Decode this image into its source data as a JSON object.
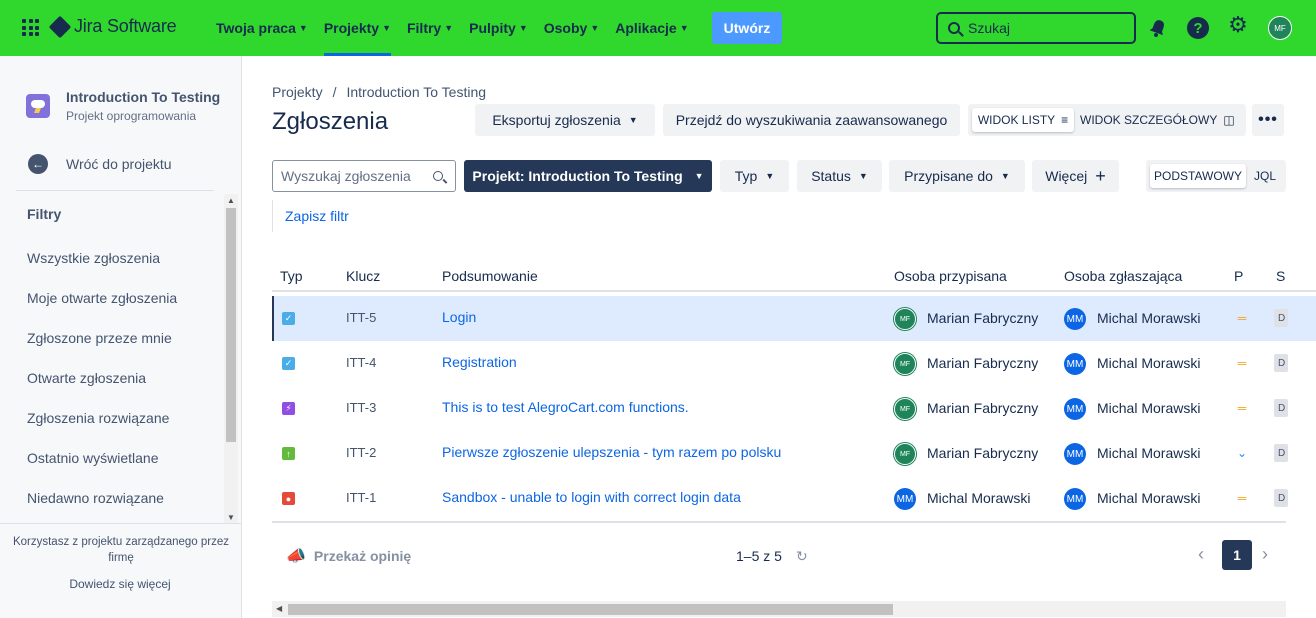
{
  "topbar": {
    "product": "Jira Software",
    "nav": [
      {
        "label": "Twoja praca",
        "active": false
      },
      {
        "label": "Projekty",
        "active": true
      },
      {
        "label": "Filtry",
        "active": false
      },
      {
        "label": "Pulpity",
        "active": false
      },
      {
        "label": "Osoby",
        "active": false
      },
      {
        "label": "Aplikacje",
        "active": false
      }
    ],
    "create_label": "Utwórz",
    "search_placeholder": "Szukaj",
    "user_initials": "MF",
    "bg_color": "#30d82e"
  },
  "sidebar": {
    "project_name": "Introduction To Testing",
    "project_type": "Projekt oprogramowania",
    "back_label": "Wróć do projektu",
    "filters_heading": "Filtry",
    "items": [
      {
        "label": "Wszystkie zgłoszenia"
      },
      {
        "label": "Moje otwarte zgłoszenia"
      },
      {
        "label": "Zgłoszone przeze mnie"
      },
      {
        "label": "Otwarte zgłoszenia"
      },
      {
        "label": "Zgłoszenia rozwiązane"
      },
      {
        "label": "Ostatnio wyświetlane"
      },
      {
        "label": "Niedawno rozwiązane"
      }
    ],
    "note": "Korzystasz z projektu zarządzanego przez firmę",
    "learn_more": "Dowiedz się więcej"
  },
  "main": {
    "breadcrumb": [
      "Projekty",
      "/",
      "Introduction To Testing"
    ],
    "title": "Zgłoszenia",
    "export_label": "Eksportuj zgłoszenia",
    "advanced_label": "Przejdź do wyszukiwania zaawansowanego",
    "view_list": "WIDOK LISTY",
    "view_detail": "WIDOK SZCZEGÓŁOWY",
    "more_label": "•••",
    "search_placeholder": "Wyszukaj zgłoszenia",
    "project_filter": "Projekt: Introduction To Testing",
    "type_filter": "Typ",
    "status_filter": "Status",
    "assignee_filter": "Przypisane do",
    "more_filter": "Więcej",
    "basic_label": "PODSTAWOWY",
    "jql_label": "JQL",
    "save_filter": "Zapisz filtr"
  },
  "table": {
    "headers": [
      "Typ",
      "Klucz",
      "Podsumowanie",
      "Osoba przypisana",
      "Osoba zgłaszająca",
      "P",
      "S"
    ],
    "rows": [
      {
        "type": "task",
        "key": "ITT-5",
        "summary": "Login",
        "assignee": "Marian Fabryczny",
        "assignee_initials": "MF",
        "reporter": "Michal Morawski",
        "reporter_initials": "MM",
        "priority": "medium",
        "status": "D",
        "selected": true
      },
      {
        "type": "task",
        "key": "ITT-4",
        "summary": "Registration",
        "assignee": "Marian Fabryczny",
        "assignee_initials": "MF",
        "reporter": "Michal Morawski",
        "reporter_initials": "MM",
        "priority": "medium",
        "status": "D",
        "selected": false
      },
      {
        "type": "epic",
        "key": "ITT-3",
        "summary": "This is to test AlegroCart.com functions.",
        "assignee": "Marian Fabryczny",
        "assignee_initials": "MF",
        "reporter": "Michal Morawski",
        "reporter_initials": "MM",
        "priority": "medium",
        "status": "D",
        "selected": false
      },
      {
        "type": "improvement",
        "key": "ITT-2",
        "summary": "Pierwsze zgłoszenie ulepszenia - tym razem po polsku",
        "assignee": "Marian Fabryczny",
        "assignee_initials": "MF",
        "reporter": "Michal Morawski",
        "reporter_initials": "MM",
        "priority": "low",
        "status": "D",
        "selected": false
      },
      {
        "type": "bug",
        "key": "ITT-1",
        "summary": "Sandbox - unable to login with correct login data",
        "assignee": "Michal Morawski",
        "assignee_initials": "MM",
        "reporter": "Michal Morawski",
        "reporter_initials": "MM",
        "priority": "medium",
        "status": "D",
        "selected": false
      }
    ]
  },
  "footer": {
    "feedback": "Przekaż opinię",
    "count": "1–5 z 5",
    "page": "1"
  },
  "colors": {
    "task": "#4bade8",
    "epic": "#904ee2",
    "improvement": "#63ba3c",
    "bug": "#e5493a"
  }
}
